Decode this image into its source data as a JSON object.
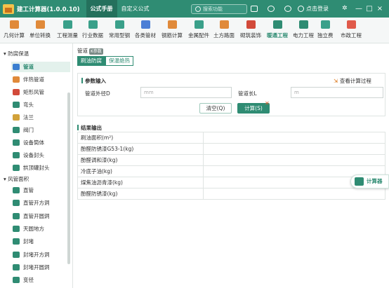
{
  "app": {
    "title": "建工计算器(1.0.0.10)"
  },
  "title_tabs": [
    {
      "label": "公式手册"
    },
    {
      "label": "自定义公式"
    }
  ],
  "search": {
    "placeholder": "搜索功能"
  },
  "login": {
    "label": "点击登录"
  },
  "window_controls": {
    "minimize": "—",
    "maximize": "□",
    "close": "×"
  },
  "toolbar": {
    "items": [
      {
        "label": "几何计算",
        "icon": "geometry-icon",
        "color": "#e08a3a"
      },
      {
        "label": "单位转换",
        "icon": "unit-convert-icon",
        "color": "#e08a3a"
      },
      {
        "label": "工程测量",
        "icon": "survey-icon",
        "color": "#3aa08a"
      },
      {
        "label": "行业数据",
        "icon": "data-icon",
        "color": "#3aa08a"
      },
      {
        "label": "常用型钢",
        "icon": "steel-icon",
        "color": "#3aa08a"
      },
      {
        "label": "各类管材",
        "icon": "pipe-icon",
        "color": "#4c7fd6"
      },
      {
        "label": "钢筋计算",
        "icon": "rebar-icon",
        "color": "#e08a3a"
      },
      {
        "label": "金属配件",
        "icon": "fitting-icon",
        "color": "#3aa08a"
      },
      {
        "label": "土方路面",
        "icon": "earthwork-icon",
        "color": "#e08a3a"
      },
      {
        "label": "砌筑装饰",
        "icon": "masonry-icon",
        "color": "#d24a3a"
      },
      {
        "label": "暖通工程",
        "icon": "hvac-icon",
        "color": "#2f8c73"
      },
      {
        "label": "电力工程",
        "icon": "power-icon",
        "color": "#2f8c73"
      },
      {
        "label": "独立费",
        "icon": "fee-icon",
        "color": "#3aa08a"
      },
      {
        "label": "市政工程",
        "icon": "municipal-icon",
        "color": "#e05a4a"
      }
    ]
  },
  "sidebar": {
    "group1": "防腐保温",
    "items1": [
      {
        "label": "管道",
        "icon": "pipe-icon",
        "color": "#3a7fd0"
      },
      {
        "label": "伴热管道",
        "icon": "heat-pipe-icon",
        "color": "#e08a3a"
      },
      {
        "label": "矩形风管",
        "icon": "duct-icon",
        "color": "#d24a3a"
      },
      {
        "label": "弯头",
        "icon": "elbow-icon",
        "color": "#2f8c73"
      },
      {
        "label": "法兰",
        "icon": "flange-icon",
        "color": "#d2a23a"
      },
      {
        "label": "阀门",
        "icon": "valve-icon",
        "color": "#2f8c73"
      },
      {
        "label": "设备筒体",
        "icon": "cylinder-icon",
        "color": "#2f8c73"
      },
      {
        "label": "设备封头",
        "icon": "head-icon",
        "color": "#2f8c73"
      },
      {
        "label": "拱顶罐封头",
        "icon": "dome-icon",
        "color": "#2f8c73"
      }
    ],
    "group2": "风管面积",
    "items2": [
      {
        "label": "直管",
        "icon": "straight-icon",
        "color": "#2f8c73"
      },
      {
        "label": "直管开方洞",
        "icon": "square-hole-icon",
        "color": "#2f8c73"
      },
      {
        "label": "直管开圆洞",
        "icon": "round-hole-icon",
        "color": "#2f8c73"
      },
      {
        "label": "天圆地方",
        "icon": "transition-icon",
        "color": "#2f8c73"
      },
      {
        "label": "封堵",
        "icon": "plug-icon",
        "color": "#2f8c73"
      },
      {
        "label": "封堵开方洞",
        "icon": "plug-square-icon",
        "color": "#2f8c73"
      },
      {
        "label": "封堵开圆洞",
        "icon": "plug-round-icon",
        "color": "#2f8c73"
      },
      {
        "label": "变径",
        "icon": "reducer-icon",
        "color": "#2f8c73"
      }
    ]
  },
  "main": {
    "breadcrumb": "管道",
    "badge": "K参数",
    "subtabs": [
      {
        "label": "刷油防腐"
      },
      {
        "label": "保温绝热"
      }
    ],
    "input_title": "参数输入",
    "view_process": "查看计算过程",
    "outer_diameter_label": "管道外径D",
    "outer_diameter_placeholder": "mm",
    "length_label": "管道长L",
    "length_placeholder": "m",
    "clear_label": "清空(Q)",
    "calc_label": "计算(S)",
    "results_title": "结果输出",
    "results": [
      {
        "label": "刷油面积(m²)",
        "value": ""
      },
      {
        "label": "酚醛防锈漆G53-1(kg)",
        "value": ""
      },
      {
        "label": "酚醛调和漆(kg)",
        "value": ""
      },
      {
        "label": "冷底子油(kg)",
        "value": ""
      },
      {
        "label": "煤焦油沥青漆(kg)",
        "value": ""
      },
      {
        "label": "酚醛防锈漆(kg)",
        "value": ""
      }
    ]
  },
  "float_calc": {
    "label": "计算器"
  }
}
